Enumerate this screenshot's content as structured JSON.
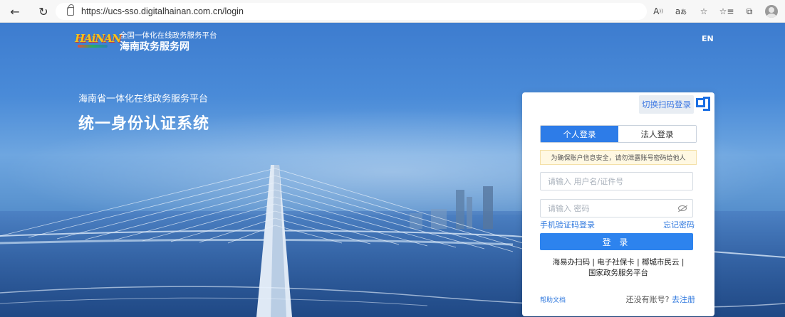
{
  "browser": {
    "url": "https://ucs-sso.digitalhainan.com.cn/login",
    "read_aloud_icon": "read-aloud-icon",
    "translate_icon": "translate-icon"
  },
  "header": {
    "logo_text": "HAiNAN",
    "site_subtitle": "全国一体化在线政务服务平台",
    "site_title": "海南政务服务网",
    "lang_switch": "EN"
  },
  "hero": {
    "subtitle": "海南省一体化在线政务服务平台",
    "title": "统一身份认证系统"
  },
  "login": {
    "qr_switch_label": "切换扫码登录",
    "tabs": [
      {
        "label": "个人登录",
        "active": true
      },
      {
        "label": "法人登录",
        "active": false
      }
    ],
    "notice": "为确保账户信息安全，请勿泄露账号密码给他人",
    "username_placeholder": "请输入 用户名/证件号",
    "password_placeholder": "请输入 密码",
    "sms_login": "手机验证码登录",
    "forgot_password": "忘记密码",
    "submit": "登 录",
    "alt_methods_line1": "海易办扫码 | 电子社保卡 | 椰城市民云 |",
    "alt_methods_line2": "国家政务服务平台",
    "help_doc": "帮助文档",
    "register_prompt": "还没有账号?",
    "register_link": "去注册"
  },
  "colors": {
    "primary": "#2d7ce8",
    "link": "#2f78de",
    "notice_bg": "#fff8e2"
  }
}
